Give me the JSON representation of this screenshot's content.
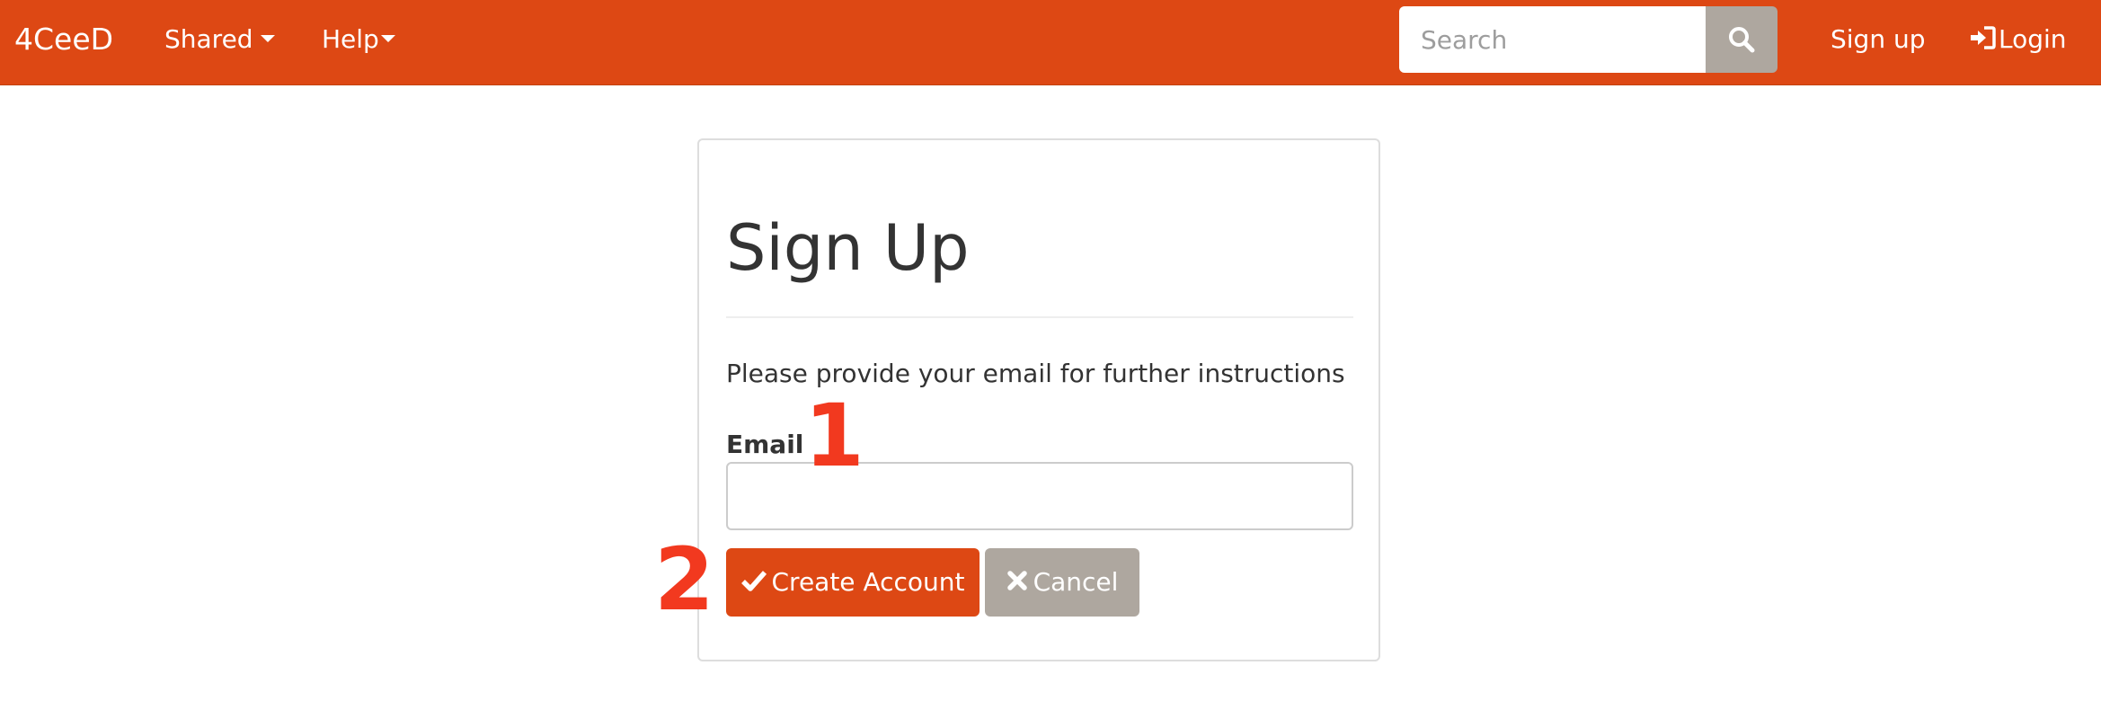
{
  "navbar": {
    "brand": "4CeeD",
    "menu": [
      {
        "label": "Shared"
      },
      {
        "label": "Help"
      }
    ],
    "search": {
      "placeholder": "Search",
      "value": ""
    },
    "signup_label": "Sign up",
    "login_label": "Login"
  },
  "form": {
    "title": "Sign Up",
    "instructions": "Please provide your email for further instructions",
    "email_label": "Email",
    "email_value": "",
    "create_label": "Create Account",
    "cancel_label": "Cancel"
  },
  "annotations": [
    "1",
    "2"
  ],
  "icons": {
    "search": "search-icon",
    "login": "sign-in-icon",
    "create": "check-icon",
    "cancel": "times-icon",
    "dropdown": "caret-down-icon"
  },
  "colors": {
    "primary": "#dd4814",
    "secondary": "#aea79f",
    "annotation": "#f2391f"
  }
}
